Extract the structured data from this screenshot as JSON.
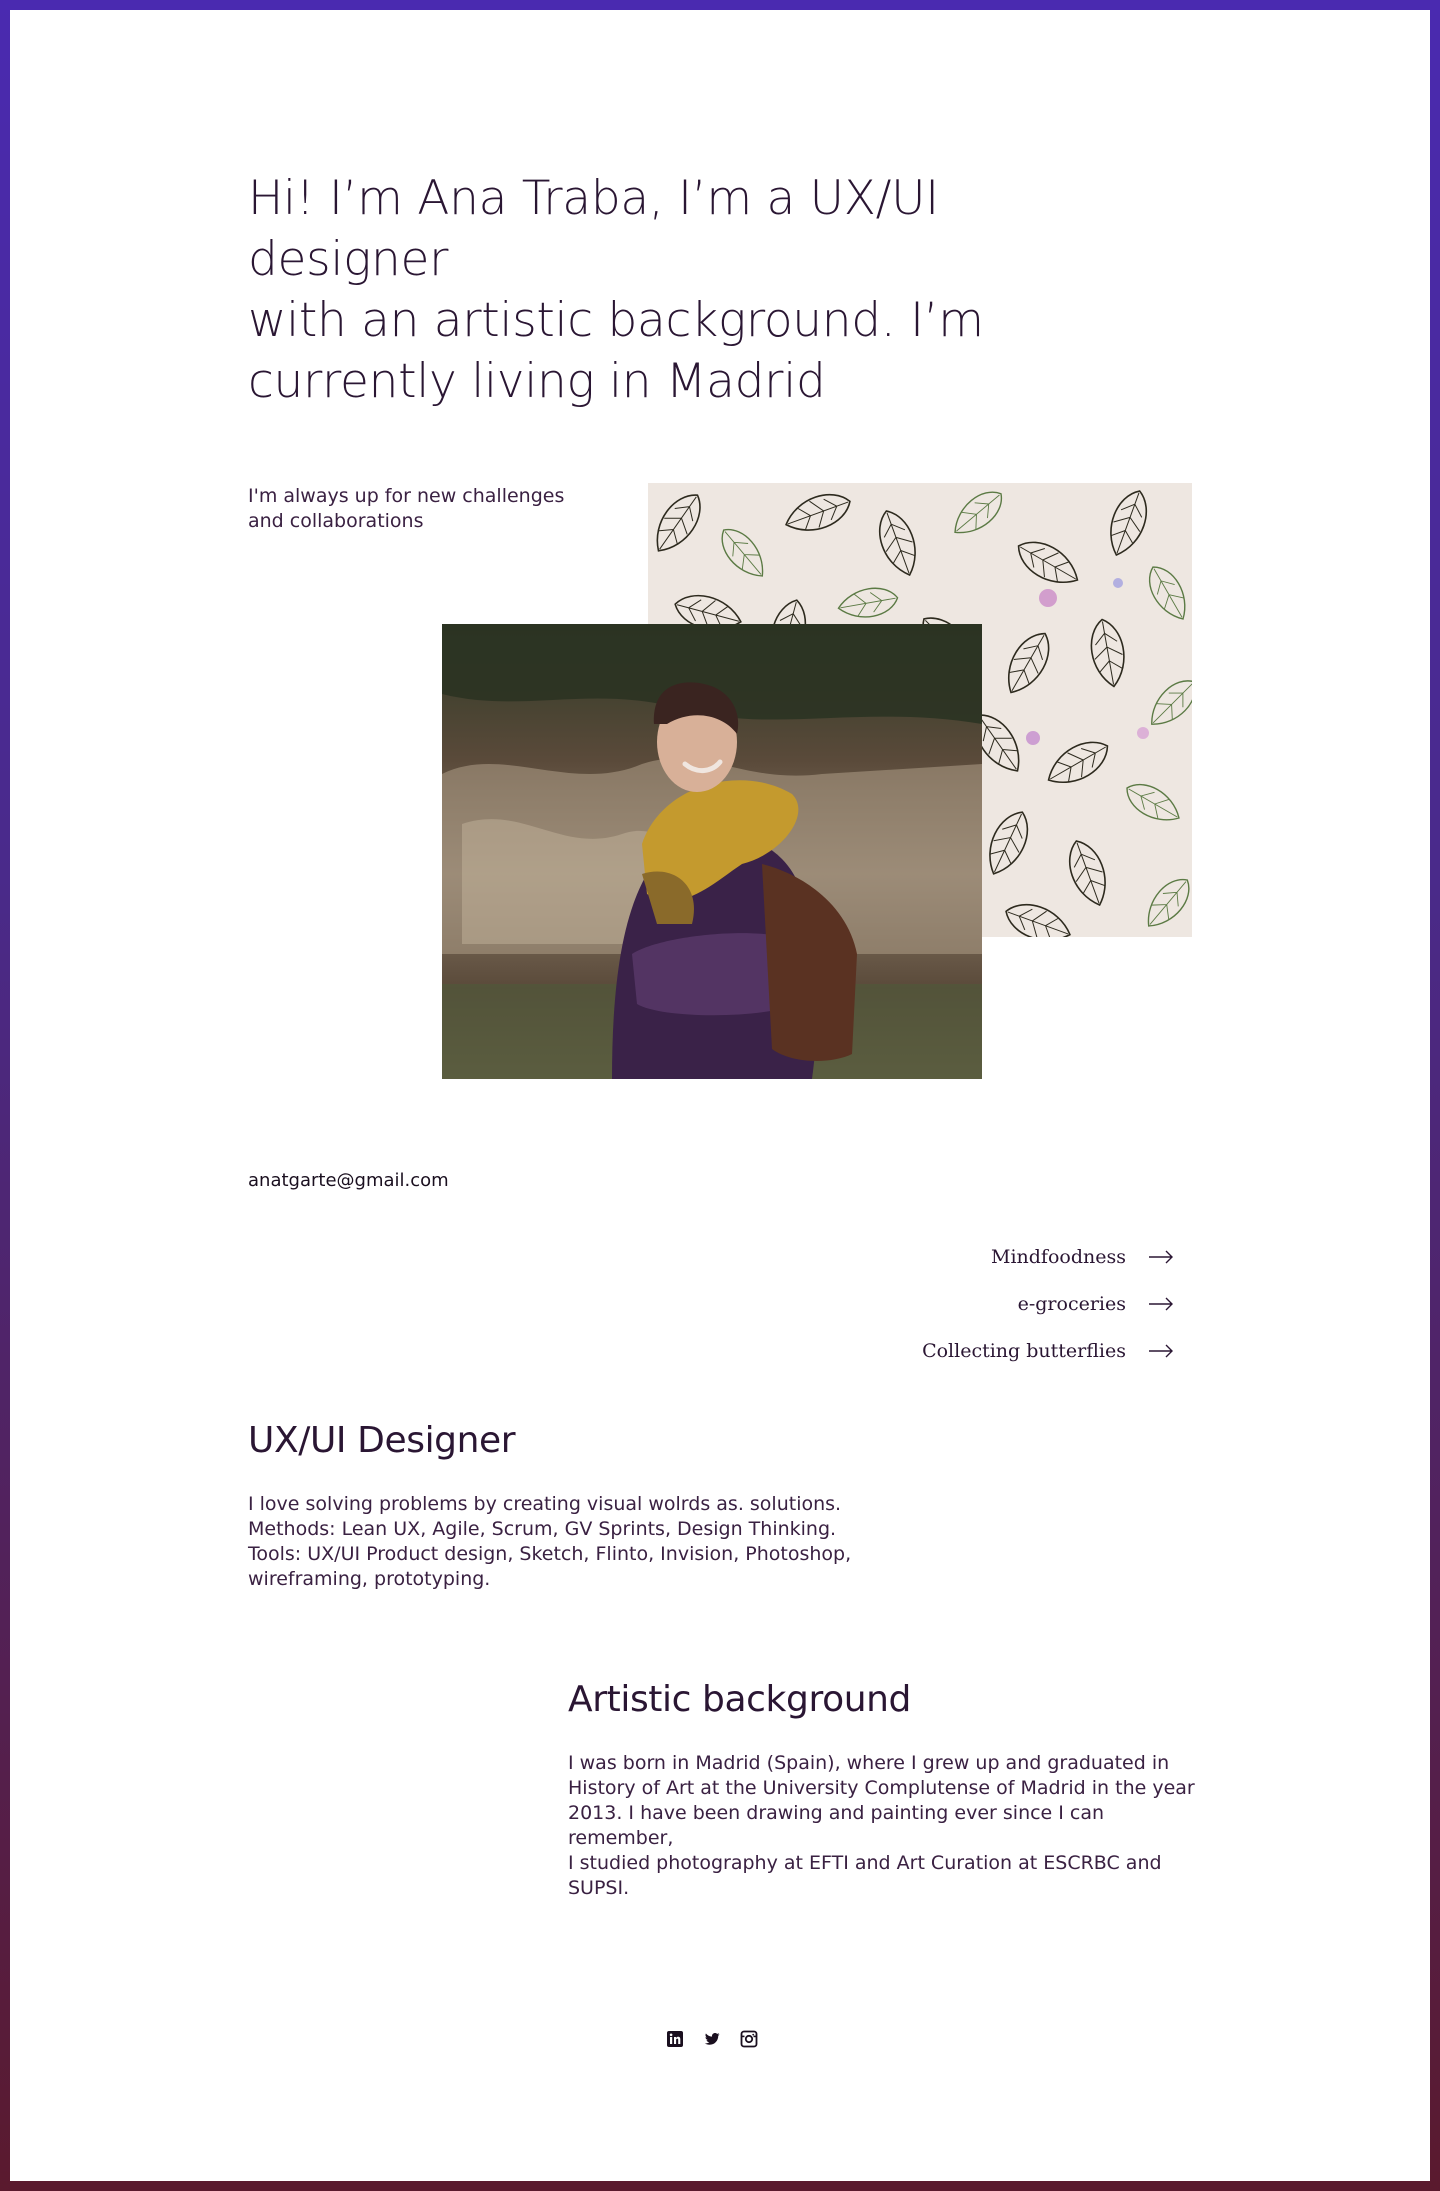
{
  "hero": {
    "line1": "Hi! I’m Ana Traba, I’m a UX/UI designer",
    "line2": "with an artistic background. I’m",
    "line3": "currently living in Madrid"
  },
  "intro": {
    "line1": "I'm always up for new challenges",
    "line2": "and collaborations"
  },
  "contact": {
    "email": "anatgarte@gmail.com"
  },
  "projects": [
    {
      "label": "Mindfoodness",
      "icon": "arrow-right-icon"
    },
    {
      "label": "e-groceries",
      "icon": "arrow-right-icon"
    },
    {
      "label": "Collecting butterflies",
      "icon": "arrow-right-icon"
    }
  ],
  "ux": {
    "title": "UX/UI Designer",
    "line1": "I love solving problems by creating visual wolrds as. solutions.",
    "line2": "Methods: Lean UX, Agile, Scrum, GV Sprints, Design Thinking.",
    "line3": "Tools: UX/UI Product design, Sketch, Flinto, Invision, Photoshop,",
    "line4": "wireframing, prototyping."
  },
  "art": {
    "title": "Artistic background",
    "line1": "I was born in Madrid (Spain), where I grew up and graduated in",
    "line2": "History of Art at the University Complutense of Madrid in the year",
    "line3": "2013. I have been drawing and painting ever since I can remember,",
    "line4": "I studied photography at EFTI and Art Curation at ESCRBC and",
    "line5": "SUPSI."
  },
  "social": [
    "linkedin-icon",
    "twitter-icon",
    "instagram-icon"
  ],
  "colors": {
    "text": "#2a1633",
    "border_top": "#4a2ab0",
    "border_bottom": "#5a1a2e",
    "pattern_bg": "#eee7e1"
  }
}
